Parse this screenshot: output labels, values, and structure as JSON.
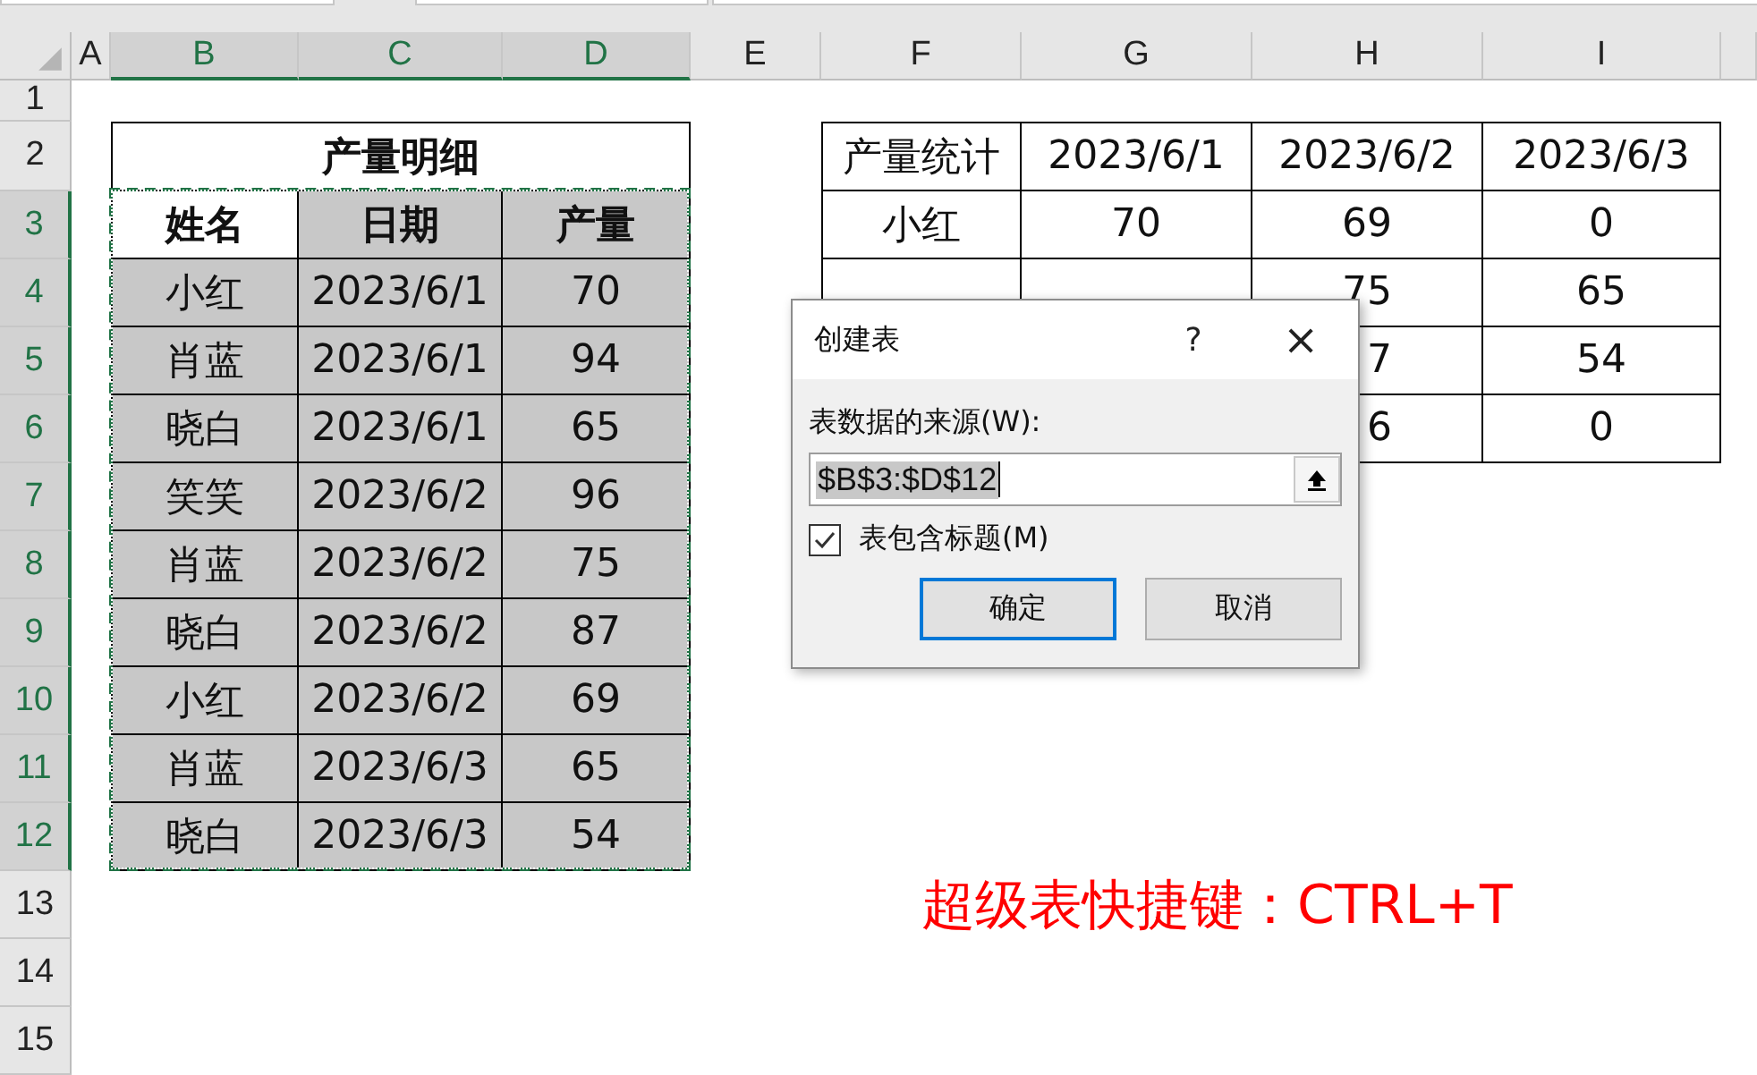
{
  "columns": [
    {
      "label": "A",
      "selected": false
    },
    {
      "label": "B",
      "selected": true
    },
    {
      "label": "C",
      "selected": true
    },
    {
      "label": "D",
      "selected": true
    },
    {
      "label": "E",
      "selected": false
    },
    {
      "label": "F",
      "selected": false
    },
    {
      "label": "G",
      "selected": false
    },
    {
      "label": "H",
      "selected": false
    },
    {
      "label": "I",
      "selected": false
    }
  ],
  "rows": [
    {
      "label": "1",
      "selected": false
    },
    {
      "label": "2",
      "selected": false
    },
    {
      "label": "3",
      "selected": true
    },
    {
      "label": "4",
      "selected": true
    },
    {
      "label": "5",
      "selected": true
    },
    {
      "label": "6",
      "selected": true
    },
    {
      "label": "7",
      "selected": true
    },
    {
      "label": "8",
      "selected": true
    },
    {
      "label": "9",
      "selected": true
    },
    {
      "label": "10",
      "selected": true
    },
    {
      "label": "11",
      "selected": true
    },
    {
      "label": "12",
      "selected": true
    },
    {
      "label": "13",
      "selected": false
    },
    {
      "label": "14",
      "selected": false
    },
    {
      "label": "15",
      "selected": false
    }
  ],
  "detail_table": {
    "title": "产量明细",
    "selected": true,
    "headers": [
      {
        "text": "姓名",
        "active": true
      },
      {
        "text": "日期",
        "active": false
      },
      {
        "text": "产量",
        "active": false
      }
    ],
    "rows": [
      [
        "小红",
        "2023/6/1",
        "70"
      ],
      [
        "肖蓝",
        "2023/6/1",
        "94"
      ],
      [
        "晓白",
        "2023/6/1",
        "65"
      ],
      [
        "笑笑",
        "2023/6/2",
        "96"
      ],
      [
        "肖蓝",
        "2023/6/2",
        "75"
      ],
      [
        "晓白",
        "2023/6/2",
        "87"
      ],
      [
        "小红",
        "2023/6/2",
        "69"
      ],
      [
        "肖蓝",
        "2023/6/3",
        "65"
      ],
      [
        "晓白",
        "2023/6/3",
        "54"
      ]
    ]
  },
  "summary_table": {
    "headers": [
      "产量统计",
      "2023/6/1",
      "2023/6/2",
      "2023/6/3"
    ],
    "rows": [
      [
        "小红",
        "70",
        "69",
        "0"
      ],
      [
        null,
        null,
        "75",
        "65"
      ],
      [
        null,
        null,
        {
          "text": "7",
          "cut_left": true
        },
        "54"
      ],
      [
        null,
        null,
        {
          "text": "6",
          "cut_left": true
        },
        "0"
      ]
    ]
  },
  "note": "超级表快捷键：CTRL+T",
  "dialog": {
    "title": "创建表",
    "help": "?",
    "close": "×",
    "source_label": "表数据的来源(W):",
    "value": "$B$3:$D$12",
    "value_selected": true,
    "has_headers": {
      "label": "表包含标题(M)",
      "checked": true
    },
    "buttons": [
      {
        "label": "确定",
        "default": true
      },
      {
        "label": "取消",
        "default": false
      }
    ]
  }
}
